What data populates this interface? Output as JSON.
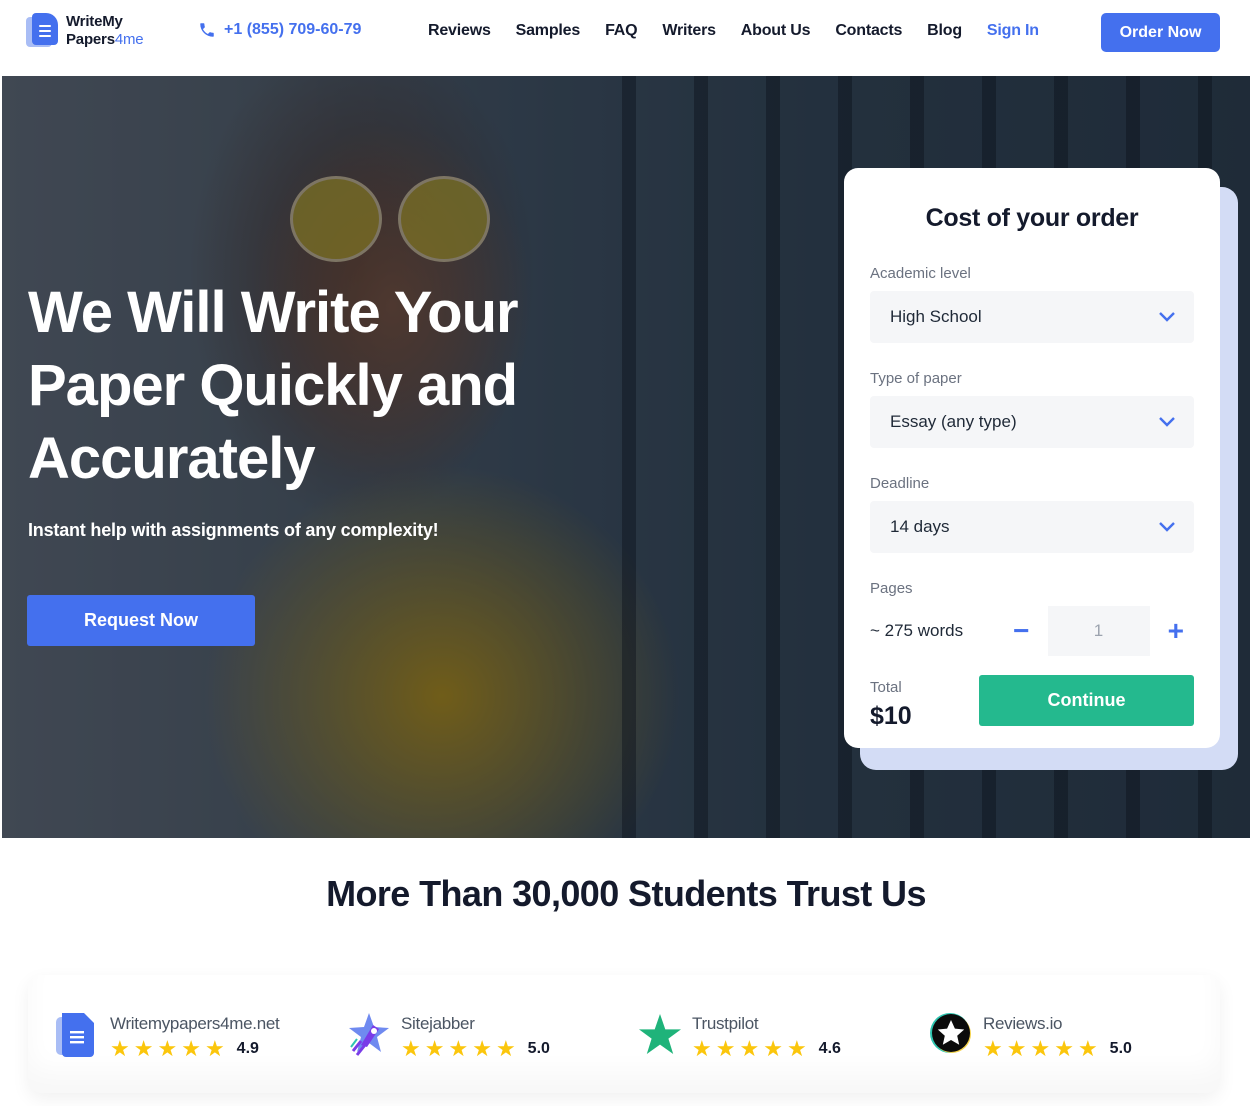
{
  "header": {
    "logo": {
      "line1": "WriteMy",
      "line2_main": "Papers",
      "line2_accent": "4me"
    },
    "phone": "+1 (855) 709-60-79",
    "nav": [
      "Reviews",
      "Samples",
      "FAQ",
      "Writers",
      "About Us",
      "Contacts",
      "Blog"
    ],
    "sign_in": "Sign In",
    "order_now": "Order Now"
  },
  "hero": {
    "title": "We Will Write Your Paper Quickly and Accurately",
    "subtitle": "Instant help with assignments of any complexity!",
    "cta": "Request Now"
  },
  "order_card": {
    "title": "Cost of your order",
    "academic_level": {
      "label": "Academic level",
      "value": "High School"
    },
    "paper_type": {
      "label": "Type of paper",
      "value": "Essay (any type)"
    },
    "deadline": {
      "label": "Deadline",
      "value": "14 days"
    },
    "pages": {
      "label": "Pages",
      "words": "~ 275 words",
      "value": "1",
      "minus": "−",
      "plus": "+"
    },
    "total": {
      "label": "Total",
      "value": "$10"
    },
    "continue": "Continue"
  },
  "trust": {
    "title": "More Than 30,000 Students Trust Us",
    "reviews": [
      {
        "name": "Writemypapers4me.net",
        "rating": "4.9",
        "stars": 5,
        "icon": "writemypapers-logo-icon"
      },
      {
        "name": "Sitejabber",
        "rating": "5.0",
        "stars": 5,
        "icon": "sitejabber-rocket-icon"
      },
      {
        "name": "Trustpilot",
        "rating": "4.6",
        "stars": 5,
        "icon": "trustpilot-star-icon"
      },
      {
        "name": "Reviews.io",
        "rating": "5.0",
        "stars": 5,
        "icon": "reviewsio-star-icon"
      }
    ]
  },
  "colors": {
    "brand_blue": "#4470ee",
    "continue_green": "#24b98e",
    "star_yellow": "#fbc60c",
    "text_dark": "#141a2c"
  }
}
